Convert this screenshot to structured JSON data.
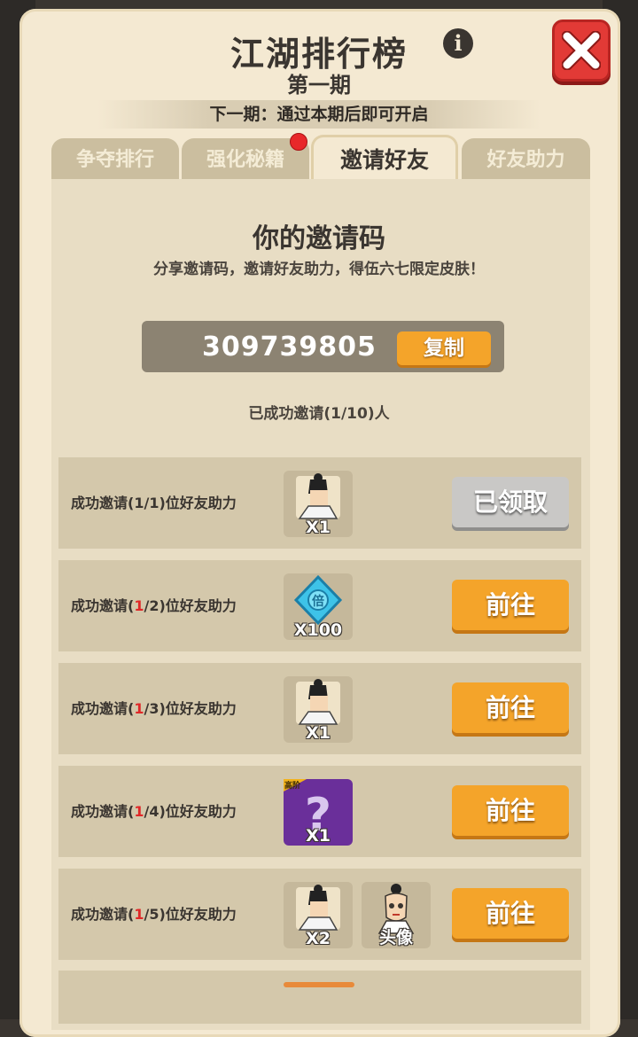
{
  "header": {
    "title": "江湖排行榜",
    "subtitle": "第一期",
    "notice": "下一期：通过本期后即可开启"
  },
  "tabs": [
    {
      "label": "争夺排行"
    },
    {
      "label": "强化秘籍"
    },
    {
      "label": "邀请好友"
    },
    {
      "label": "好友助力"
    }
  ],
  "active_tab": "邀请好友",
  "invite": {
    "title": "你的邀请码",
    "description": "分享邀请码，邀请好友助力，得伍六七限定皮肤！",
    "code": "309739805",
    "copy_label": "复制",
    "success_count": "已成功邀请(1/10)人"
  },
  "rewards": [
    {
      "prefix": "成功邀请(",
      "current": "1",
      "suffix": "/1)位好友助力",
      "items": [
        {
          "icon": "character-portrait-icon",
          "qty": "X1"
        }
      ],
      "button": "已领取"
    },
    {
      "prefix": "成功邀请(",
      "current": "1",
      "suffix": "/2)位好友助力",
      "items": [
        {
          "icon": "blue-gem-icon",
          "qty": "X100"
        }
      ],
      "button": "前往"
    },
    {
      "prefix": "成功邀请(",
      "current": "1",
      "suffix": "/3)位好友助力",
      "items": [
        {
          "icon": "character-portrait-icon",
          "qty": "X1"
        }
      ],
      "button": "前往"
    },
    {
      "prefix": "成功邀请(",
      "current": "1",
      "suffix": "/4)位好友助力",
      "items": [
        {
          "icon": "mystery-box-icon",
          "badge": "高阶",
          "qty": "X1"
        }
      ],
      "button": "前往"
    },
    {
      "prefix": "成功邀请(",
      "current": "1",
      "suffix": "/5)位好友助力",
      "items": [
        {
          "icon": "character-portrait-icon",
          "qty": "X2"
        },
        {
          "icon": "avatar-icon",
          "qty": "头像"
        }
      ],
      "button": "前往"
    }
  ],
  "gem_glyph": "倍",
  "colors": {
    "accent_orange": "#f4a42a",
    "claimed_gray": "#c9c8c6",
    "close_red": "#e23a36",
    "highlight_red": "#e02828"
  }
}
